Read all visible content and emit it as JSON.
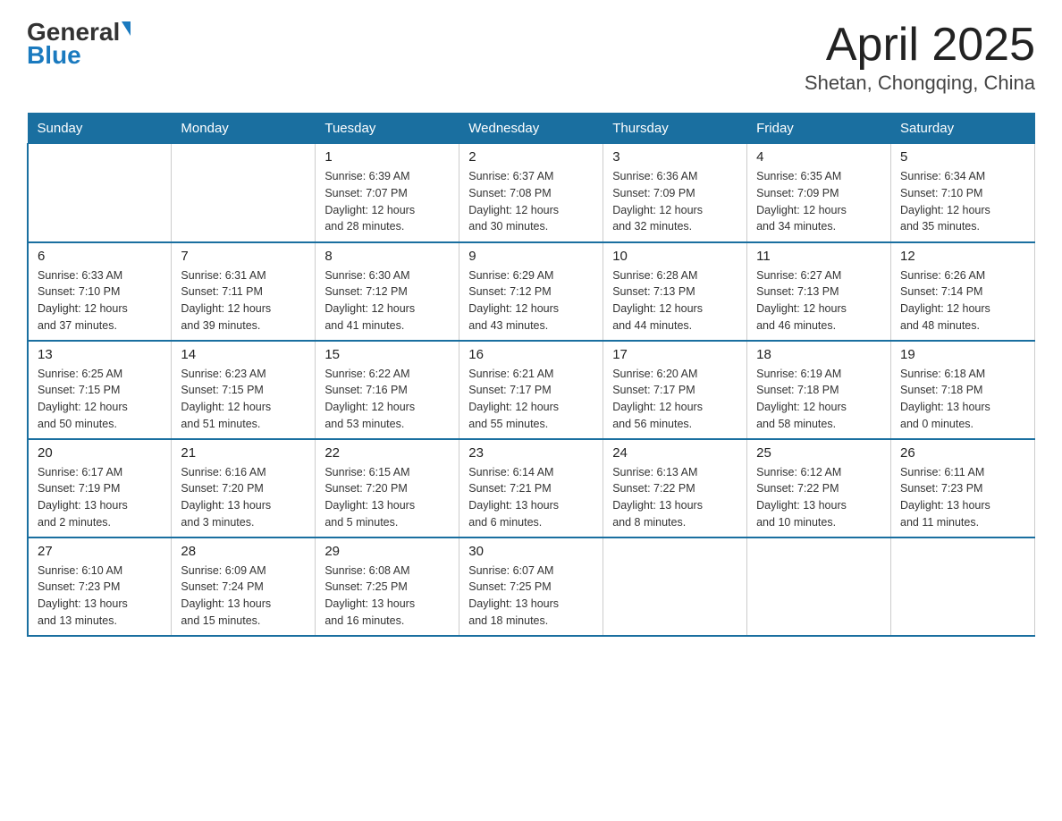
{
  "header": {
    "logo_general": "General",
    "logo_blue": "Blue",
    "title": "April 2025",
    "subtitle": "Shetan, Chongqing, China"
  },
  "days_of_week": [
    "Sunday",
    "Monday",
    "Tuesday",
    "Wednesday",
    "Thursday",
    "Friday",
    "Saturday"
  ],
  "weeks": [
    [
      {
        "day": "",
        "info": ""
      },
      {
        "day": "",
        "info": ""
      },
      {
        "day": "1",
        "info": "Sunrise: 6:39 AM\nSunset: 7:07 PM\nDaylight: 12 hours\nand 28 minutes."
      },
      {
        "day": "2",
        "info": "Sunrise: 6:37 AM\nSunset: 7:08 PM\nDaylight: 12 hours\nand 30 minutes."
      },
      {
        "day": "3",
        "info": "Sunrise: 6:36 AM\nSunset: 7:09 PM\nDaylight: 12 hours\nand 32 minutes."
      },
      {
        "day": "4",
        "info": "Sunrise: 6:35 AM\nSunset: 7:09 PM\nDaylight: 12 hours\nand 34 minutes."
      },
      {
        "day": "5",
        "info": "Sunrise: 6:34 AM\nSunset: 7:10 PM\nDaylight: 12 hours\nand 35 minutes."
      }
    ],
    [
      {
        "day": "6",
        "info": "Sunrise: 6:33 AM\nSunset: 7:10 PM\nDaylight: 12 hours\nand 37 minutes."
      },
      {
        "day": "7",
        "info": "Sunrise: 6:31 AM\nSunset: 7:11 PM\nDaylight: 12 hours\nand 39 minutes."
      },
      {
        "day": "8",
        "info": "Sunrise: 6:30 AM\nSunset: 7:12 PM\nDaylight: 12 hours\nand 41 minutes."
      },
      {
        "day": "9",
        "info": "Sunrise: 6:29 AM\nSunset: 7:12 PM\nDaylight: 12 hours\nand 43 minutes."
      },
      {
        "day": "10",
        "info": "Sunrise: 6:28 AM\nSunset: 7:13 PM\nDaylight: 12 hours\nand 44 minutes."
      },
      {
        "day": "11",
        "info": "Sunrise: 6:27 AM\nSunset: 7:13 PM\nDaylight: 12 hours\nand 46 minutes."
      },
      {
        "day": "12",
        "info": "Sunrise: 6:26 AM\nSunset: 7:14 PM\nDaylight: 12 hours\nand 48 minutes."
      }
    ],
    [
      {
        "day": "13",
        "info": "Sunrise: 6:25 AM\nSunset: 7:15 PM\nDaylight: 12 hours\nand 50 minutes."
      },
      {
        "day": "14",
        "info": "Sunrise: 6:23 AM\nSunset: 7:15 PM\nDaylight: 12 hours\nand 51 minutes."
      },
      {
        "day": "15",
        "info": "Sunrise: 6:22 AM\nSunset: 7:16 PM\nDaylight: 12 hours\nand 53 minutes."
      },
      {
        "day": "16",
        "info": "Sunrise: 6:21 AM\nSunset: 7:17 PM\nDaylight: 12 hours\nand 55 minutes."
      },
      {
        "day": "17",
        "info": "Sunrise: 6:20 AM\nSunset: 7:17 PM\nDaylight: 12 hours\nand 56 minutes."
      },
      {
        "day": "18",
        "info": "Sunrise: 6:19 AM\nSunset: 7:18 PM\nDaylight: 12 hours\nand 58 minutes."
      },
      {
        "day": "19",
        "info": "Sunrise: 6:18 AM\nSunset: 7:18 PM\nDaylight: 13 hours\nand 0 minutes."
      }
    ],
    [
      {
        "day": "20",
        "info": "Sunrise: 6:17 AM\nSunset: 7:19 PM\nDaylight: 13 hours\nand 2 minutes."
      },
      {
        "day": "21",
        "info": "Sunrise: 6:16 AM\nSunset: 7:20 PM\nDaylight: 13 hours\nand 3 minutes."
      },
      {
        "day": "22",
        "info": "Sunrise: 6:15 AM\nSunset: 7:20 PM\nDaylight: 13 hours\nand 5 minutes."
      },
      {
        "day": "23",
        "info": "Sunrise: 6:14 AM\nSunset: 7:21 PM\nDaylight: 13 hours\nand 6 minutes."
      },
      {
        "day": "24",
        "info": "Sunrise: 6:13 AM\nSunset: 7:22 PM\nDaylight: 13 hours\nand 8 minutes."
      },
      {
        "day": "25",
        "info": "Sunrise: 6:12 AM\nSunset: 7:22 PM\nDaylight: 13 hours\nand 10 minutes."
      },
      {
        "day": "26",
        "info": "Sunrise: 6:11 AM\nSunset: 7:23 PM\nDaylight: 13 hours\nand 11 minutes."
      }
    ],
    [
      {
        "day": "27",
        "info": "Sunrise: 6:10 AM\nSunset: 7:23 PM\nDaylight: 13 hours\nand 13 minutes."
      },
      {
        "day": "28",
        "info": "Sunrise: 6:09 AM\nSunset: 7:24 PM\nDaylight: 13 hours\nand 15 minutes."
      },
      {
        "day": "29",
        "info": "Sunrise: 6:08 AM\nSunset: 7:25 PM\nDaylight: 13 hours\nand 16 minutes."
      },
      {
        "day": "30",
        "info": "Sunrise: 6:07 AM\nSunset: 7:25 PM\nDaylight: 13 hours\nand 18 minutes."
      },
      {
        "day": "",
        "info": ""
      },
      {
        "day": "",
        "info": ""
      },
      {
        "day": "",
        "info": ""
      }
    ]
  ]
}
